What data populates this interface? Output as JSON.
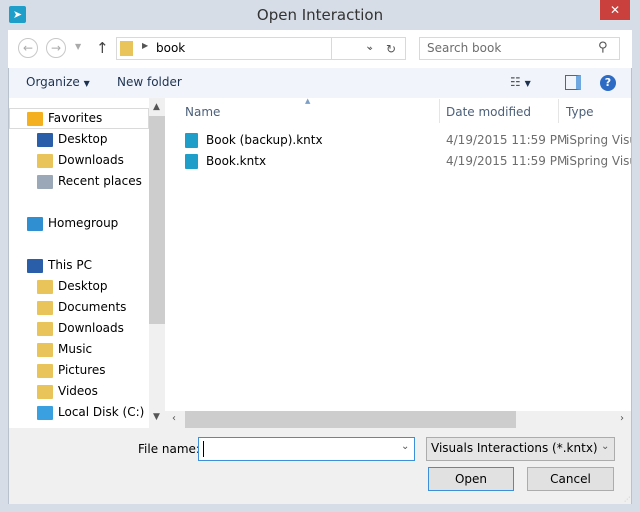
{
  "window": {
    "title": "Open Interaction",
    "close_label": "✕"
  },
  "nav": {
    "back": "←",
    "forward": "→",
    "up": "↑",
    "breadcrumb": "book",
    "search_placeholder": "Search book"
  },
  "toolbar": {
    "organize": "Organize",
    "new_folder": "New folder"
  },
  "sidebar": {
    "items": [
      {
        "label": "Favorites",
        "icon": "star-icon",
        "color": "#f5b020"
      },
      {
        "label": "Desktop",
        "icon": "desktop-icon",
        "color": "#2a5ea8"
      },
      {
        "label": "Downloads",
        "icon": "downloads-folder-icon",
        "color": "#e8c45a"
      },
      {
        "label": "Recent places",
        "icon": "recent-places-icon",
        "color": "#9aa8b8"
      },
      {
        "label": "Homegroup",
        "icon": "homegroup-icon",
        "color": "#2f8fd0"
      },
      {
        "label": "This PC",
        "icon": "computer-icon",
        "color": "#2a5ea8"
      },
      {
        "label": "Desktop",
        "icon": "desktop-folder-icon",
        "color": "#e8c45a"
      },
      {
        "label": "Documents",
        "icon": "documents-folder-icon",
        "color": "#e8c45a"
      },
      {
        "label": "Downloads",
        "icon": "downloads-folder-icon",
        "color": "#e8c45a"
      },
      {
        "label": "Music",
        "icon": "music-folder-icon",
        "color": "#e8c45a"
      },
      {
        "label": "Pictures",
        "icon": "pictures-folder-icon",
        "color": "#e8c45a"
      },
      {
        "label": "Videos",
        "icon": "videos-folder-icon",
        "color": "#e8c45a"
      },
      {
        "label": "Local Disk (C:)",
        "icon": "local-disk-icon",
        "color": "#3aa0e0"
      }
    ]
  },
  "columns": {
    "name": "Name",
    "date": "Date modified",
    "type": "Type"
  },
  "files": [
    {
      "name": "Book (backup).kntx",
      "date": "4/19/2015 11:59 PM",
      "type": "iSpring Visuals Interactions"
    },
    {
      "name": "Book.kntx",
      "date": "4/19/2015 11:59 PM",
      "type": "iSpring Visuals Interactions"
    }
  ],
  "footer": {
    "file_name_label": "File name:",
    "file_name_value": "",
    "file_type": "Visuals Interactions (*.kntx)",
    "open": "Open",
    "cancel": "Cancel"
  }
}
